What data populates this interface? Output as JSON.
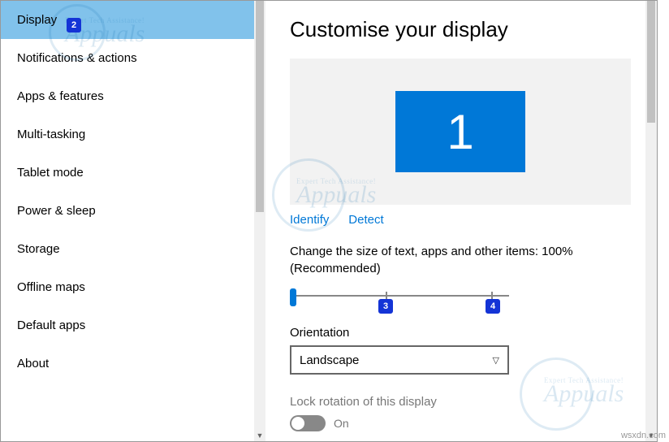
{
  "sidebar": {
    "items": [
      {
        "label": "Display",
        "selected": true
      },
      {
        "label": "Notifications & actions"
      },
      {
        "label": "Apps & features"
      },
      {
        "label": "Multi-tasking"
      },
      {
        "label": "Tablet mode"
      },
      {
        "label": "Power & sleep"
      },
      {
        "label": "Storage"
      },
      {
        "label": "Offline maps"
      },
      {
        "label": "Default apps"
      },
      {
        "label": "About"
      }
    ]
  },
  "main": {
    "title": "Customise your display",
    "monitor_number": "1",
    "identify_label": "Identify",
    "detect_label": "Detect",
    "scale_label_line1": "Change the size of text, apps and other items: 100%",
    "scale_label_line2": "(Recommended)",
    "orientation_label": "Orientation",
    "orientation_value": "Landscape",
    "lock_rotation_label": "Lock rotation of this display",
    "toggle_value": "On"
  },
  "annotations": {
    "a2": "2",
    "a3": "3",
    "a4": "4"
  },
  "footer": {
    "credit": "wsxdn.com"
  }
}
